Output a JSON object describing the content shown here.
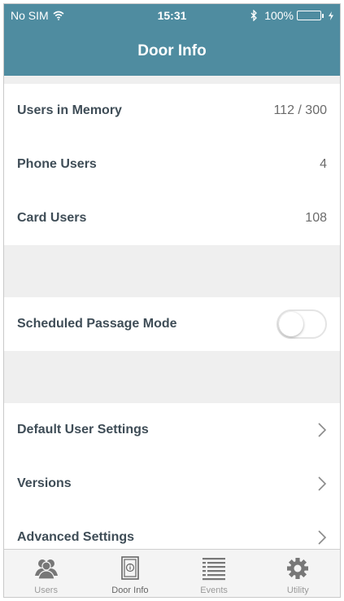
{
  "status_bar": {
    "carrier": "No SIM",
    "time": "15:31",
    "battery": "100%"
  },
  "nav": {
    "title": "Door Info"
  },
  "info_rows": [
    {
      "label": "Users in Memory",
      "value": "112 / 300"
    },
    {
      "label": "Phone Users",
      "value": "4"
    },
    {
      "label": "Card Users",
      "value": "108"
    }
  ],
  "passage": {
    "label": "Scheduled Passage Mode",
    "enabled": false
  },
  "menu_rows": [
    {
      "label": "Default User Settings",
      "icon": "chevron-right-icon"
    },
    {
      "label": "Versions",
      "icon": "chevron-right-icon"
    },
    {
      "label": "Advanced Settings",
      "icon": "chevron-right-icon"
    }
  ],
  "tabs": [
    {
      "label": "Users",
      "icon": "users-icon",
      "active": false
    },
    {
      "label": "Door Info",
      "icon": "door-info-icon",
      "active": true
    },
    {
      "label": "Events",
      "icon": "events-list-icon",
      "active": false
    },
    {
      "label": "Utility",
      "icon": "gear-icon",
      "active": false
    }
  ],
  "colors": {
    "header": "#4f8ca0",
    "battery": "#37d65a",
    "section_gap": "#efefef",
    "label_text": "#3f4d57",
    "tab_icon": "#777777"
  }
}
